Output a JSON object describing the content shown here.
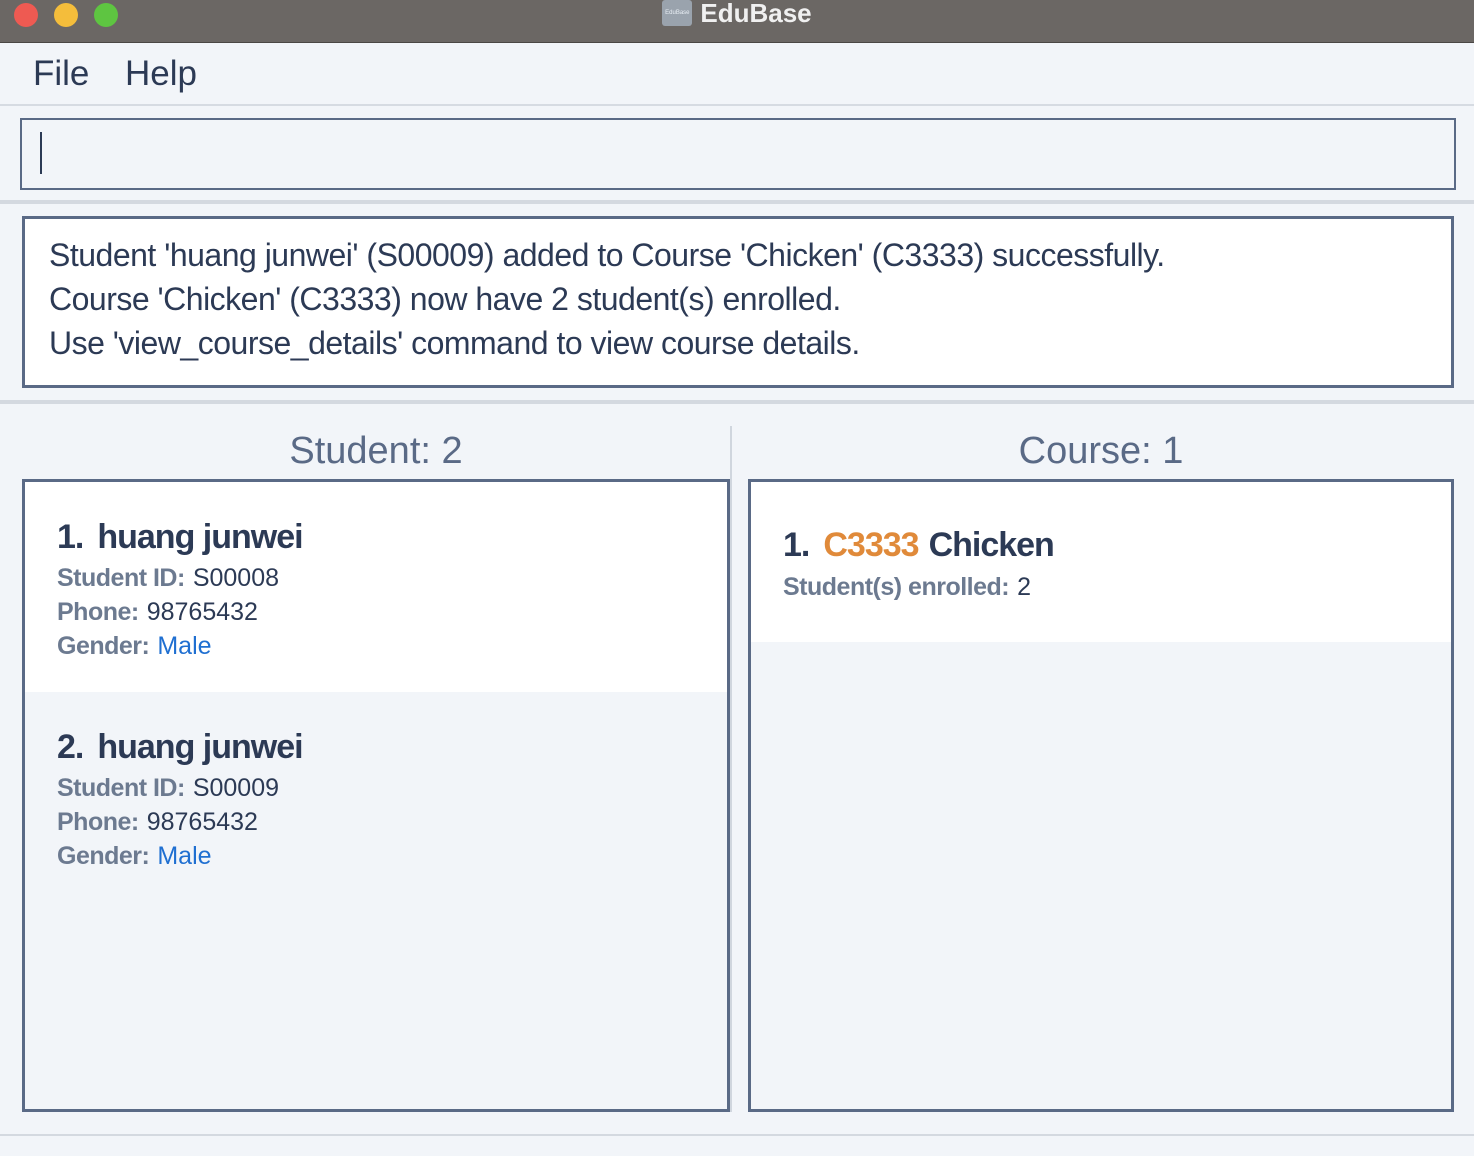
{
  "window": {
    "title": "EduBase",
    "icon": "EduBase"
  },
  "menu": {
    "file": "File",
    "help": "Help"
  },
  "command": {
    "value": ""
  },
  "result": {
    "lines": [
      "Student 'huang junwei' (S00009) added to Course 'Chicken' (C3333) successfully.",
      "Course 'Chicken' (C3333) now have 2 student(s) enrolled.",
      "Use 'view_course_details' command to view course details."
    ]
  },
  "students": {
    "header": "Student: 2",
    "items": [
      {
        "index": "1.",
        "name": "huang junwei",
        "id_label": "Student ID:",
        "id": "S00008",
        "phone_label": "Phone:",
        "phone": "98765432",
        "gender_label": "Gender:",
        "gender": "Male"
      },
      {
        "index": "2.",
        "name": "huang junwei",
        "id_label": "Student ID:",
        "id": "S00009",
        "phone_label": "Phone:",
        "phone": "98765432",
        "gender_label": "Gender:",
        "gender": "Male"
      }
    ]
  },
  "courses": {
    "header": "Course: 1",
    "items": [
      {
        "index": "1.",
        "code": "C3333",
        "name": "Chicken",
        "enrolled_label": "Student(s) enrolled:",
        "enrolled": "2"
      }
    ]
  },
  "colors": {
    "accent_code": "#e08a3a",
    "gender_link": "#1f6fd1",
    "border": "#5a6a86"
  }
}
